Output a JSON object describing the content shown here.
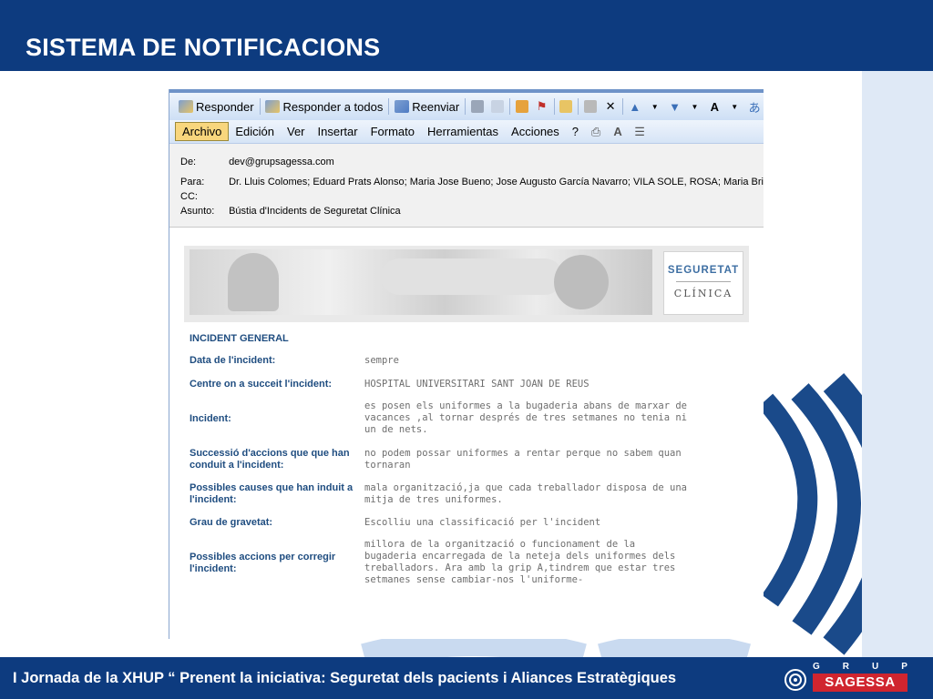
{
  "slide": {
    "title": "SISTEMA DE NOTIFICACIONS",
    "footer": "I Jornada de la XHUP “ Prenent la iniciativa: Seguretat dels pacients i Aliances Estratègiques",
    "logo_grup": [
      "G",
      "R",
      "U",
      "P"
    ],
    "logo_name": "SAGESSA",
    "colors": {
      "band": "#0d3b7f",
      "logo_red": "#d0252f",
      "strip": "#dfe9f6"
    }
  },
  "toolbar": {
    "reply": {
      "label": "Responder",
      "icon": "reply-icon"
    },
    "reply_all": {
      "label": "Responder a todos",
      "icon": "reply-all-icon"
    },
    "forward": {
      "label": "Reenviar",
      "icon": "forward-icon"
    }
  },
  "menu": [
    "Archivo",
    "Edición",
    "Ver",
    "Insertar",
    "Formato",
    "Herramientas",
    "Acciones",
    "?"
  ],
  "email": {
    "from_label": "De:",
    "from": "dev@grupsagessa.com",
    "to_label": "Para:",
    "to": "Dr. Lluis Colomes; Eduard Prats Alonso; Maria Jose Bueno; Jose Augusto García Navarro; VILA SOLE, ROSA; Maria Brians",
    "cc_label": "CC:",
    "cc": "",
    "subject_label": "Asunto:",
    "subject": "Bústia d'Incidents de Seguretat Clínica"
  },
  "banner": {
    "logo_line1": "SEGURETAT",
    "logo_line2": "CLÍNICA"
  },
  "form": {
    "section": "INCIDENT GENERAL",
    "rows": [
      {
        "label": "Data de l'incident:",
        "value": "sempre"
      },
      {
        "label": "Centre on a succeit l'incident:",
        "value": "HOSPITAL UNIVERSITARI SANT JOAN DE REUS"
      },
      {
        "label": "Incident:",
        "value": "es posen els uniformes a la bugaderia abans de marxar de vacances ,al tornar després de tres setmanes no tenia ni un de nets."
      },
      {
        "label": "Successió d'accions que que han conduit a l'incident:",
        "value": "no podem possar uniformes a rentar perque no sabem quan tornaran"
      },
      {
        "label": "Possibles causes que han induit a l'incident:",
        "value": "mala organització,ja que cada treballador disposa de una mitja de tres uniformes."
      },
      {
        "label": "Grau de gravetat:",
        "value": "Escolliu una classificació per l'incident"
      },
      {
        "label": "Possibles accions per corregir l'incident:",
        "value": "millora de la organització o funcionament de la bugaderia encarregada de la neteja dels uniformes dels treballadors. Ara amb la grip A,tindrem que estar tres setmanes sense cambiar-nos l'uniforme-"
      }
    ]
  }
}
